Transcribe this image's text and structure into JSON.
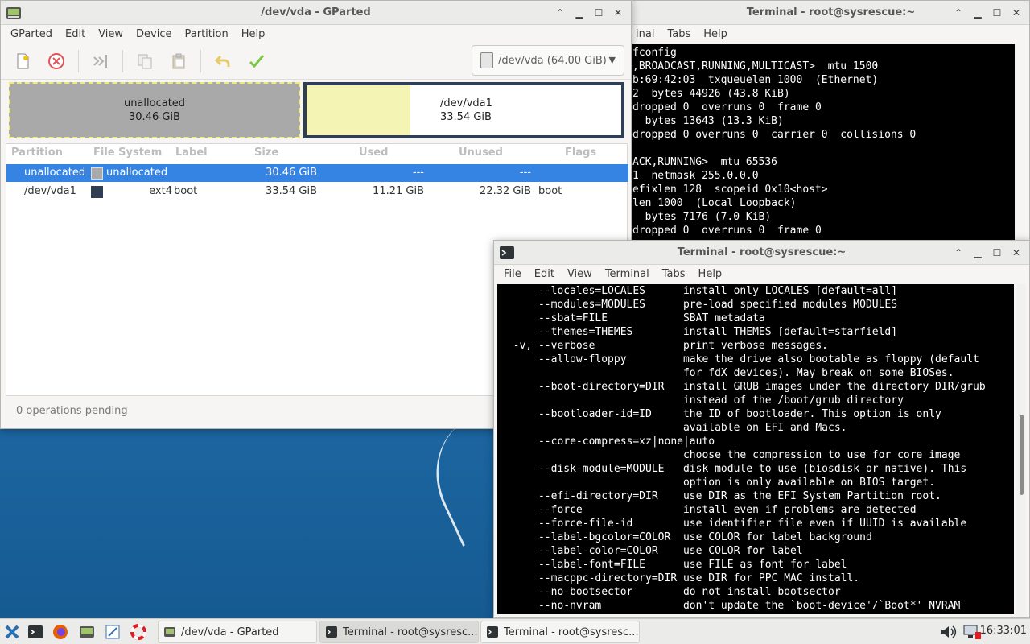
{
  "desktop": {},
  "gparted": {
    "title": "/dev/vda - GParted",
    "menu": [
      "GParted",
      "Edit",
      "View",
      "Device",
      "Partition",
      "Help"
    ],
    "toolbar": [
      "new-icon",
      "delete-icon",
      "resize-icon",
      "copy-icon",
      "paste-icon",
      "undo-icon",
      "apply-icon"
    ],
    "device_selector": "/dev/vda (64.00 GiB)",
    "disk_map": {
      "unallocated": {
        "name": "unallocated",
        "size": "30.46 GiB"
      },
      "partition": {
        "name": "/dev/vda1",
        "size": "33.54 GiB",
        "used_fraction": 0.33
      }
    },
    "columns": [
      "Partition",
      "File System",
      "Label",
      "Size",
      "Used",
      "Unused",
      "Flags"
    ],
    "rows": [
      {
        "partition": "unallocated",
        "fs": "unallocated",
        "label": "",
        "size": "30.46 GiB",
        "used": "---",
        "unused": "---",
        "flags": "",
        "color": "#a9a9a9",
        "selected": true
      },
      {
        "partition": "/dev/vda1",
        "fs": "ext4",
        "label": "boot",
        "size": "33.54 GiB",
        "used": "11.21 GiB",
        "unused": "22.32 GiB",
        "flags": "boot",
        "color": "#2f3e52",
        "selected": false
      }
    ],
    "status": "0 operations pending"
  },
  "terminal_back": {
    "title": "Terminal - root@sysrescue:~",
    "menu": [
      "inal",
      "Tabs",
      "Help"
    ],
    "lines": [
      "fconfig",
      ",BROADCAST,RUNNING,MULTICAST>  mtu 1500",
      "b:69:42:03  txqueuelen 1000  (Ethernet)",
      "2  bytes 44926 (43.8 KiB)",
      "dropped 0  overruns 0  frame 0",
      "  bytes 13643 (13.3 KiB)",
      "dropped 0 overruns 0  carrier 0  collisions 0",
      "",
      "ACK,RUNNING>  mtu 65536",
      "1  netmask 255.0.0.0",
      "efixlen 128  scopeid 0x10<host>",
      "len 1000  (Local Loopback)",
      "  bytes 7176 (7.0 KiB)",
      "dropped 0  overruns 0  frame 0"
    ]
  },
  "terminal_front": {
    "title": "Terminal - root@sysrescue:~",
    "menu": [
      "File",
      "Edit",
      "View",
      "Terminal",
      "Tabs",
      "Help"
    ],
    "lines": [
      "      --locales=LOCALES      install only LOCALES [default=all]",
      "      --modules=MODULES      pre-load specified modules MODULES",
      "      --sbat=FILE            SBAT metadata",
      "      --themes=THEMES        install THEMES [default=starfield]",
      "  -v, --verbose              print verbose messages.",
      "      --allow-floppy         make the drive also bootable as floppy (default",
      "                             for fdX devices). May break on some BIOSes.",
      "      --boot-directory=DIR   install GRUB images under the directory DIR/grub",
      "                             instead of the /boot/grub directory",
      "      --bootloader-id=ID     the ID of bootloader. This option is only",
      "                             available on EFI and Macs.",
      "      --core-compress=xz|none|auto",
      "                             choose the compression to use for core image",
      "      --disk-module=MODULE   disk module to use (biosdisk or native). This",
      "                             option is only available on BIOS target.",
      "      --efi-directory=DIR    use DIR as the EFI System Partition root.",
      "      --force                install even if problems are detected",
      "      --force-file-id        use identifier file even if UUID is available",
      "      --label-bgcolor=COLOR  use COLOR for label background",
      "      --label-color=COLOR    use COLOR for label",
      "      --label-font=FILE      use FILE as font for label",
      "      --macppc-directory=DIR use DIR for PPC MAC install.",
      "      --no-bootsector        do not install bootsector",
      "      --no-nvram             don't update the `boot-device'/`Boot*' NVRAM"
    ]
  },
  "taskbar": {
    "tasks": [
      "/dev/vda - GParted",
      "Terminal - root@sysresc...",
      "Terminal - root@sysresc..."
    ],
    "clock": "16:33:01"
  }
}
